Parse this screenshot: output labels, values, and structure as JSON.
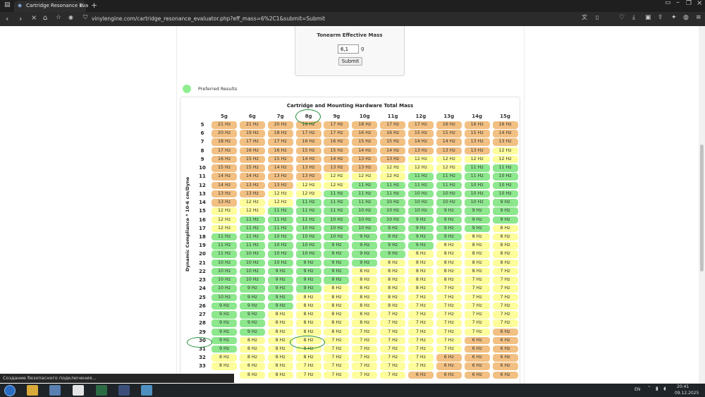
{
  "browser": {
    "tab_title": "Cartridge Resonance Eva",
    "url": "vinylengine.com/cartridge_resonance_evaluator.php?eff_mass=6%2C1&submit=Submit",
    "status_text": "Создание безопасного подключения..."
  },
  "form": {
    "title": "Tonearm Effective Mass",
    "value": "6,1",
    "unit": "g",
    "submit_label": "Submit"
  },
  "legend": {
    "label": "Preferred Results",
    "color": "#90ee90"
  },
  "table": {
    "title": "Cartridge and Mounting Hardware Total Mass",
    "row_axis_label": "Dynamic Compliance * 10-6 cm/Dyne",
    "columns": [
      "5g",
      "6g",
      "7g",
      "8g",
      "9g",
      "10g",
      "11g",
      "12g",
      "13g",
      "14g",
      "15g"
    ],
    "rows": [
      {
        "label": "5",
        "cells": [
          "21 Hz",
          "21 Hz",
          "20 Hz",
          "19 Hz",
          "17 Hz",
          "18 Hz",
          "17 Hz",
          "17 Hz",
          "16 Hz",
          "16 Hz",
          "16 Hz"
        ]
      },
      {
        "label": "6",
        "cells": [
          "20 Hz",
          "19 Hz",
          "18 Hz",
          "17 Hz",
          "17 Hz",
          "16 Hz",
          "16 Hz",
          "15 Hz",
          "15 Hz",
          "15 Hz",
          "14 Hz"
        ]
      },
      {
        "label": "7",
        "cells": [
          "18 Hz",
          "17 Hz",
          "17 Hz",
          "16 Hz",
          "16 Hz",
          "15 Hz",
          "15 Hz",
          "14 Hz",
          "14 Hz",
          "13 Hz",
          "13 Hz"
        ]
      },
      {
        "label": "8",
        "cells": [
          "17 Hz",
          "16 Hz",
          "16 Hz",
          "15 Hz",
          "15 Hz",
          "14 Hz",
          "14 Hz",
          "13 Hz",
          "13 Hz",
          "13 Hz",
          "12 Hz"
        ]
      },
      {
        "label": "9",
        "cells": [
          "16 Hz",
          "15 Hz",
          "15 Hz",
          "14 Hz",
          "14 Hz",
          "13 Hz",
          "13 Hz",
          "12 Hz",
          "12 Hz",
          "12 Hz",
          "12 Hz"
        ]
      },
      {
        "label": "10",
        "cells": [
          "15 Hz",
          "15 Hz",
          "14 Hz",
          "13 Hz",
          "13 Hz",
          "13 Hz",
          "12 Hz",
          "12 Hz",
          "12 Hz",
          "11 Hz",
          "11 Hz"
        ]
      },
      {
        "label": "11",
        "cells": [
          "14 Hz",
          "14 Hz",
          "13 Hz",
          "13 Hz",
          "12 Hz",
          "12 Hz",
          "12 Hz",
          "11 Hz",
          "11 Hz",
          "11 Hz",
          "10 Hz"
        ]
      },
      {
        "label": "12",
        "cells": [
          "14 Hz",
          "13 Hz",
          "13 Hz",
          "12 Hz",
          "12 Hz",
          "11 Hz",
          "11 Hz",
          "11 Hz",
          "11 Hz",
          "10 Hz",
          "10 Hz"
        ]
      },
      {
        "label": "13",
        "cells": [
          "13 Hz",
          "13 Hz",
          "12 Hz",
          "12 Hz",
          "11 Hz",
          "11 Hz",
          "11 Hz",
          "10 Hz",
          "10 Hz",
          "10 Hz",
          "10 Hz"
        ]
      },
      {
        "label": "14",
        "cells": [
          "13 Hz",
          "12 Hz",
          "12 Hz",
          "11 Hz",
          "11 Hz",
          "11 Hz",
          "10 Hz",
          "10 Hz",
          "10 Hz",
          "10 Hz",
          "9 Hz"
        ]
      },
      {
        "label": "15",
        "cells": [
          "12 Hz",
          "12 Hz",
          "11 Hz",
          "11 Hz",
          "11 Hz",
          "10 Hz",
          "10 Hz",
          "10 Hz",
          "9 Hz",
          "9 Hz",
          "9 Hz"
        ]
      },
      {
        "label": "16",
        "cells": [
          "12 Hz",
          "11 Hz",
          "11 Hz",
          "11 Hz",
          "10 Hz",
          "10 Hz",
          "10 Hz",
          "9 Hz",
          "9 Hz",
          "9 Hz",
          "9 Hz"
        ]
      },
      {
        "label": "17",
        "cells": [
          "12 Hz",
          "11 Hz",
          "11 Hz",
          "10 Hz",
          "10 Hz",
          "10 Hz",
          "9 Hz",
          "9 Hz",
          "9 Hz",
          "9 Hz",
          "8 Hz"
        ]
      },
      {
        "label": "18",
        "cells": [
          "11 Hz",
          "11 Hz",
          "10 Hz",
          "10 Hz",
          "10 Hz",
          "9 Hz",
          "9 Hz",
          "9 Hz",
          "9 Hz",
          "8 Hz",
          "8 Hz"
        ]
      },
      {
        "label": "19",
        "cells": [
          "11 Hz",
          "11 Hz",
          "10 Hz",
          "10 Hz",
          "9 Hz",
          "9 Hz",
          "9 Hz",
          "9 Hz",
          "8 Hz",
          "8 Hz",
          "8 Hz"
        ]
      },
      {
        "label": "20",
        "cells": [
          "11 Hz",
          "10 Hz",
          "10 Hz",
          "10 Hz",
          "9 Hz",
          "9 Hz",
          "9 Hz",
          "8 Hz",
          "8 Hz",
          "8 Hz",
          "8 Hz"
        ]
      },
      {
        "label": "21",
        "cells": [
          "10 Hz",
          "10 Hz",
          "10 Hz",
          "9 Hz",
          "9 Hz",
          "9 Hz",
          "8 Hz",
          "8 Hz",
          "8 Hz",
          "8 Hz",
          "8 Hz"
        ]
      },
      {
        "label": "22",
        "cells": [
          "10 Hz",
          "10 Hz",
          "9 Hz",
          "9 Hz",
          "9 Hz",
          "8 Hz",
          "8 Hz",
          "8 Hz",
          "8 Hz",
          "8 Hz",
          "7 Hz"
        ]
      },
      {
        "label": "23",
        "cells": [
          "10 Hz",
          "10 Hz",
          "9 Hz",
          "9 Hz",
          "9 Hz",
          "8 Hz",
          "8 Hz",
          "8 Hz",
          "8 Hz",
          "7 Hz",
          "7 Hz"
        ]
      },
      {
        "label": "24",
        "cells": [
          "10 Hz",
          "9 Hz",
          "9 Hz",
          "9 Hz",
          "8 Hz",
          "8 Hz",
          "8 Hz",
          "8 Hz",
          "7 Hz",
          "7 Hz",
          "7 Hz"
        ]
      },
      {
        "label": "25",
        "cells": [
          "10 Hz",
          "9 Hz",
          "9 Hz",
          "8 Hz",
          "8 Hz",
          "8 Hz",
          "8 Hz",
          "7 Hz",
          "7 Hz",
          "7 Hz",
          "7 Hz"
        ]
      },
      {
        "label": "26",
        "cells": [
          "9 Hz",
          "9 Hz",
          "9 Hz",
          "8 Hz",
          "8 Hz",
          "8 Hz",
          "8 Hz",
          "7 Hz",
          "7 Hz",
          "7 Hz",
          "7 Hz"
        ]
      },
      {
        "label": "27",
        "cells": [
          "9 Hz",
          "9 Hz",
          "8 Hz",
          "8 Hz",
          "8 Hz",
          "8 Hz",
          "7 Hz",
          "7 Hz",
          "7 Hz",
          "7 Hz",
          "7 Hz"
        ]
      },
      {
        "label": "28",
        "cells": [
          "9 Hz",
          "9 Hz",
          "8 Hz",
          "8 Hz",
          "8 Hz",
          "8 Hz",
          "7 Hz",
          "7 Hz",
          "7 Hz",
          "7 Hz",
          "7 Hz"
        ]
      },
      {
        "label": "29",
        "cells": [
          "9 Hz",
          "9 Hz",
          "8 Hz",
          "8 Hz",
          "8 Hz",
          "7 Hz",
          "7 Hz",
          "7 Hz",
          "7 Hz",
          "7 Hz",
          "6 Hz"
        ]
      },
      {
        "label": "30",
        "cells": [
          "9 Hz",
          "8 Hz",
          "8 Hz",
          "8 Hz",
          "7 Hz",
          "7 Hz",
          "7 Hz",
          "7 Hz",
          "7 Hz",
          "6 Hz",
          "6 Hz"
        ]
      },
      {
        "label": "31",
        "cells": [
          "9 Hz",
          "8 Hz",
          "8 Hz",
          "8 Hz",
          "7 Hz",
          "7 Hz",
          "7 Hz",
          "7 Hz",
          "7 Hz",
          "6 Hz",
          "6 Hz"
        ]
      },
      {
        "label": "32",
        "cells": [
          "8 Hz",
          "8 Hz",
          "8 Hz",
          "8 Hz",
          "7 Hz",
          "7 Hz",
          "7 Hz",
          "7 Hz",
          "6 Hz",
          "6 Hz",
          "6 Hz"
        ]
      },
      {
        "label": "33",
        "cells": [
          "8 Hz",
          "8 Hz",
          "8 Hz",
          "7 Hz",
          "7 Hz",
          "7 Hz",
          "7 Hz",
          "7 Hz",
          "6 Hz",
          "6 Hz",
          "6 Hz"
        ]
      },
      {
        "label": "",
        "cells": [
          "",
          "8 Hz",
          "8 Hz",
          "7 Hz",
          "7 Hz",
          "7 Hz",
          "7 Hz",
          "6 Hz",
          "6 Hz",
          "6 Hz",
          "6 Hz"
        ]
      }
    ]
  },
  "taskbar": {
    "language": "EN",
    "time": "20:41",
    "date": "09.12.2025"
  },
  "colors": {
    "preferred": "#8de78d",
    "acceptable": "#fdfd9b",
    "out_of_range": "#f2c083",
    "annotation": "#1f8d3a"
  },
  "icons": [
    "back-icon",
    "forward-icon",
    "stop-icon",
    "home-icon",
    "bookmark-icon",
    "translate-icon",
    "reader-icon",
    "share-icon",
    "extensions-icon",
    "menu-icon"
  ]
}
